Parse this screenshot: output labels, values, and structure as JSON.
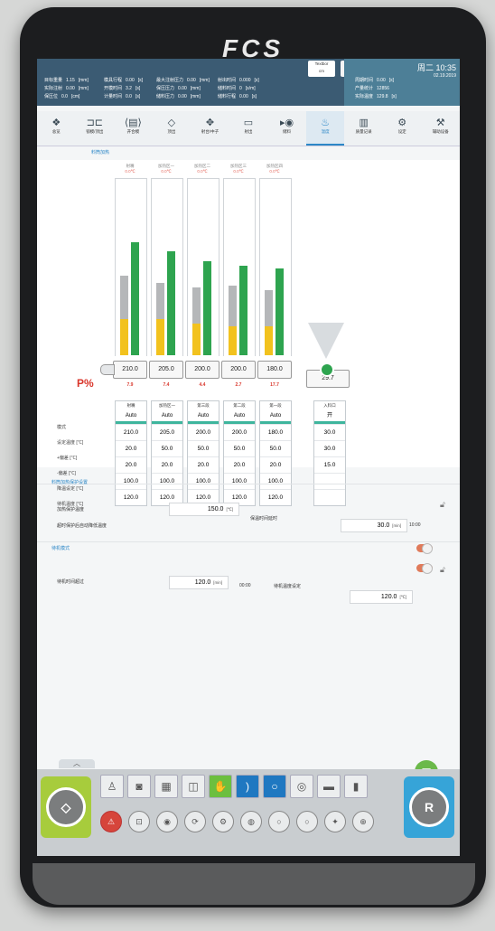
{
  "brand": "FCS",
  "status": {
    "left": [
      {
        "label": "目标重量",
        "value": "1.15",
        "unit": "[mm]"
      },
      {
        "label": "实际注射",
        "value": "0.00",
        "unit": "[mm]"
      },
      {
        "label": "保压位",
        "value": "0.0",
        "unit": "[cm]"
      }
    ],
    "mid": [
      {
        "label": "模具行程",
        "value": "0.00",
        "unit": "[s]"
      },
      {
        "label": "开模时间",
        "value": "3.2",
        "unit": "[s]"
      },
      {
        "label": "计量时间",
        "value": "0.0",
        "unit": "[s]"
      }
    ],
    "mid2": [
      {
        "label": "最大注射压力",
        "value": "0.00",
        "unit": "[mm]"
      },
      {
        "label": "保压压力",
        "value": "0.00",
        "unit": "[mm]"
      },
      {
        "label": "储料压力",
        "value": "0.00",
        "unit": "[mm]"
      }
    ],
    "mid3": [
      {
        "label": "射出时间",
        "value": "0.000",
        "unit": "[s]"
      },
      {
        "label": "储料时间",
        "value": "0",
        "unit": "[s/m]"
      },
      {
        "label": "储料行程",
        "value": "0.00",
        "unit": "[s]"
      }
    ],
    "right": [
      {
        "label": "周期时间",
        "value": "0.00",
        "unit": "[s]"
      },
      {
        "label": "产量统计",
        "value": "12856"
      },
      {
        "label": "实际温度",
        "value": "129.8",
        "unit": "[s]"
      }
    ],
    "user": "Textbor",
    "user_sub": "cm",
    "clock": "周二 10:35",
    "date": "02.19.2019"
  },
  "nav": [
    {
      "icon": "❖",
      "label": "总览"
    },
    {
      "icon": "⊐⊏",
      "label": "锁模/顶出"
    },
    {
      "icon": "⟨▤⟩",
      "label": "开合模"
    },
    {
      "icon": "◇",
      "label": "顶出"
    },
    {
      "icon": "✥",
      "label": "射台/中子"
    },
    {
      "icon": "▭",
      "label": "射出"
    },
    {
      "icon": "▸◉",
      "label": "储料"
    },
    {
      "icon": "♨",
      "label": "温度"
    },
    {
      "icon": "▥",
      "label": "质量记录"
    },
    {
      "icon": "⚙",
      "label": "设定"
    },
    {
      "icon": "⚒",
      "label": "辅助设备"
    }
  ],
  "subtab": "料筒加热",
  "zones": [
    {
      "name": "射嘴",
      "temp": "0.0℃",
      "barrel": "210.0",
      "pct": "7.9",
      "yellow": 0.25,
      "gray": 0.3,
      "green": 0.78
    },
    {
      "name": "加热区一",
      "temp": "0.0℃",
      "barrel": "205.0",
      "pct": "7.4",
      "yellow": 0.25,
      "gray": 0.25,
      "green": 0.72
    },
    {
      "name": "加热区二",
      "temp": "0.0℃",
      "barrel": "200.0",
      "pct": "4.4",
      "yellow": 0.22,
      "gray": 0.25,
      "green": 0.65
    },
    {
      "name": "加热区三",
      "temp": "0.0℃",
      "barrel": "200.0",
      "pct": "2.7",
      "yellow": 0.2,
      "gray": 0.28,
      "green": 0.62
    },
    {
      "name": "加热区四",
      "temp": "0.0℃",
      "barrel": "180.0",
      "pct": "17.7",
      "yellow": 0.2,
      "gray": 0.25,
      "green": 0.6
    }
  ],
  "feed_barrel": "29.7",
  "p_label": "P%",
  "table": {
    "row_labels": [
      "模式",
      "设定温度 [℃]",
      "+偏差 [℃]",
      "-偏差 [℃]",
      "降温设定 [℃]",
      "待机温度 [℃]"
    ],
    "cols": [
      {
        "head": "射嘴",
        "mode": "Auto",
        "vals": [
          "210.0",
          "20.0",
          "20.0",
          "100.0",
          "120.0"
        ]
      },
      {
        "head": "加热区一",
        "mode": "Auto",
        "vals": [
          "205.0",
          "50.0",
          "20.0",
          "100.0",
          "120.0"
        ]
      },
      {
        "head": "第三段",
        "mode": "Auto",
        "vals": [
          "200.0",
          "50.0",
          "20.0",
          "100.0",
          "120.0"
        ]
      },
      {
        "head": "第二段",
        "mode": "Auto",
        "vals": [
          "200.0",
          "50.0",
          "20.0",
          "100.0",
          "120.0"
        ]
      },
      {
        "head": "第一段",
        "mode": "Auto",
        "vals": [
          "180.0",
          "50.0",
          "20.0",
          "100.0",
          "120.0"
        ]
      }
    ],
    "feed": {
      "head": "入料口",
      "mode": "开",
      "vals": [
        "30.0",
        "30.0",
        "15.0",
        "",
        ""
      ]
    }
  },
  "section2": "料筒加热保护设置",
  "settings": {
    "max_temp_label": "加热保护温度",
    "max_temp": "150.0",
    "max_temp_unit": "[℃]",
    "delay_label": "保温时间延时",
    "delay": "30.0",
    "delay_unit": "[min]",
    "delay_extra": "10:00",
    "note": "超时保护后自动降低温度",
    "standby_section": "待机模式",
    "standby_label": "待机时间超过",
    "standby": "120.0",
    "standby_unit": "[min]",
    "standby_time": "00:00",
    "standby_temp_label": "待机温度设定",
    "standby_temp": "120.0",
    "standby_temp_unit": "[℃]"
  },
  "bottom": {
    "row1": [
      "♙",
      "◙",
      "▦",
      "◫",
      "✋",
      ")",
      "○",
      "◎",
      "▬",
      "▮"
    ],
    "row2": [
      "⚠",
      "⊡",
      "◉",
      "⟳",
      "⚙",
      "◍",
      "○",
      "○",
      "✦",
      "⊕"
    ],
    "left_btn": "◇",
    "right_btn": "R"
  },
  "colors": {
    "accent": "#2c87c7",
    "green": "#2ea44f",
    "yellow": "#f2c21e",
    "gray": "#b5b7b9",
    "red": "#d9362b",
    "status": "#3b5b73"
  }
}
